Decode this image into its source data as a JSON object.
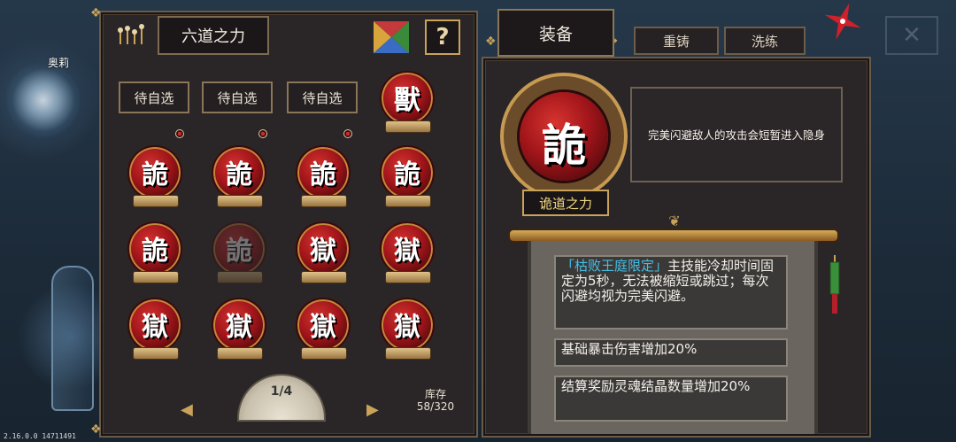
{
  "left_panel": {
    "title": "六道之力",
    "help_label": "?",
    "pending_slots": [
      "待自选",
      "待自选",
      "待自选"
    ],
    "top_right_medal_glyph": "獸",
    "grid_medals": [
      {
        "glyph": "詭",
        "dim": false
      },
      {
        "glyph": "詭",
        "dim": false
      },
      {
        "glyph": "詭",
        "dim": false
      },
      {
        "glyph": "詭",
        "dim": false
      },
      {
        "glyph": "詭",
        "dim": false
      },
      {
        "glyph": "詭",
        "dim": true
      },
      {
        "glyph": "獄",
        "dim": false
      },
      {
        "glyph": "獄",
        "dim": false
      },
      {
        "glyph": "獄",
        "dim": false
      },
      {
        "glyph": "獄",
        "dim": false
      },
      {
        "glyph": "獄",
        "dim": false
      },
      {
        "glyph": "獄",
        "dim": false
      }
    ],
    "page": "1/4",
    "storage_label": "库存",
    "storage_value": "58/320"
  },
  "right_panel": {
    "tabs": {
      "equip": "装备",
      "reforge": "重铸",
      "refine": "洗练"
    },
    "selected_medal_glyph": "詭",
    "selected_medal_name": "诡道之力",
    "description": "完美闪避敌人的攻击会短暂进入隐身",
    "effects": [
      {
        "highlight": "「枯败王庭限定」",
        "text": "主技能冷却时间固定为5秒，无法被缩短或跳过；每次闪避均视为完美闪避。"
      },
      {
        "highlight": "",
        "text": "基础暴击伤害增加20%"
      },
      {
        "highlight": "",
        "text": "结算奖励灵魂结晶数量增加20%"
      }
    ]
  },
  "character_name": "奥莉",
  "version": "2.16.0.0 14711491",
  "colors": {
    "accent_gold": "#c9a35a",
    "medal_red": "#a1151a",
    "highlight_cyan": "#44c0e6"
  }
}
